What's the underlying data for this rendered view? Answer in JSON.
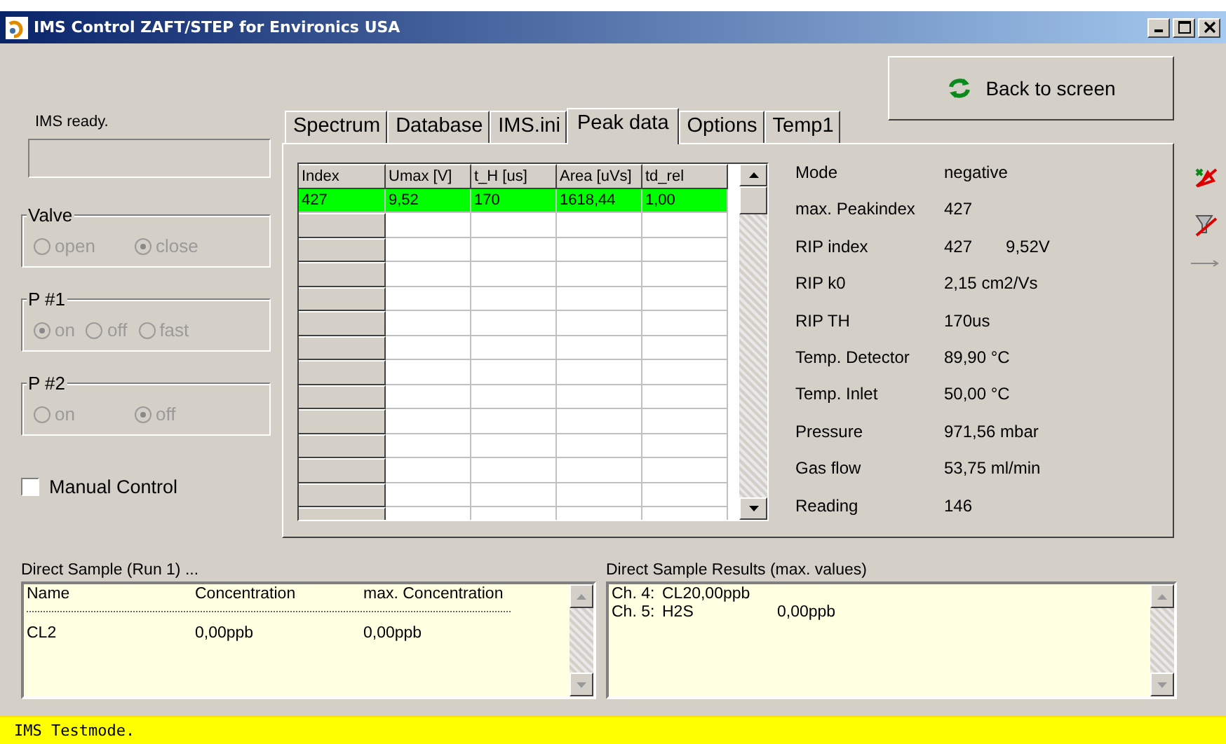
{
  "window": {
    "title": "IMS Control ZAFT/STEP for Environics USA"
  },
  "left": {
    "status": "IMS ready.",
    "groups": [
      {
        "title": "Valve",
        "options": [
          {
            "label": "open",
            "selected": false
          },
          {
            "label": "close",
            "selected": true
          }
        ]
      },
      {
        "title": "P #1",
        "options": [
          {
            "label": "on",
            "selected": true
          },
          {
            "label": "off",
            "selected": false
          },
          {
            "label": "fast",
            "selected": false
          }
        ]
      },
      {
        "title": "P #2",
        "options": [
          {
            "label": "on",
            "selected": false
          },
          {
            "label": "off",
            "selected": true
          }
        ]
      }
    ],
    "manual_control": {
      "label": "Manual Control",
      "checked": false
    }
  },
  "back_button": "Back to screen",
  "tabs": [
    {
      "label": "Spectrum",
      "selected": false
    },
    {
      "label": "Database",
      "selected": false
    },
    {
      "label": "IMS.ini",
      "selected": false
    },
    {
      "label": "Peak data",
      "selected": true
    },
    {
      "label": "Options",
      "selected": false
    },
    {
      "label": "Temp1",
      "selected": false
    }
  ],
  "peak_table": {
    "columns": [
      "Index",
      "Umax [V]",
      "t_H [us]",
      "Area [uVs]",
      "td_rel"
    ],
    "rows": [
      {
        "cells": [
          "427",
          "9,52",
          "170",
          "1618,44",
          "1,00"
        ],
        "highlighted": true
      }
    ]
  },
  "info": [
    {
      "label": "Mode",
      "values": [
        "negative"
      ]
    },
    {
      "label": "max. Peakindex",
      "values": [
        "427"
      ]
    },
    {
      "label": "RIP index",
      "values": [
        "427",
        "9,52V"
      ]
    },
    {
      "label": "RIP k0",
      "values": [
        "2,15 cm2/Vs"
      ]
    },
    {
      "label": "RIP TH",
      "values": [
        "170us"
      ]
    },
    {
      "label": "Temp. Detector",
      "values": [
        "89,90 °C"
      ]
    },
    {
      "label": "Temp. Inlet",
      "values": [
        "50,00 °C"
      ]
    },
    {
      "label": "Pressure",
      "values": [
        "971,56 mbar"
      ]
    },
    {
      "label": "Gas flow",
      "values": [
        "53,75 ml/min"
      ]
    },
    {
      "label": "Reading",
      "values": [
        "146"
      ]
    }
  ],
  "direct_sample": {
    "title": "Direct Sample (Run 1) ...",
    "columns": [
      "Name",
      "Concentration",
      "max. Concentration"
    ],
    "rows": [
      [
        "CL2",
        "0,00ppb",
        "0,00ppb"
      ]
    ]
  },
  "results": {
    "title": "Direct Sample Results (max. values)",
    "lines": [
      {
        "channel": "Ch. 4:",
        "name": "CL20,00ppb"
      },
      {
        "channel": "Ch. 5:",
        "name": "H2S",
        "value": "0,00ppb"
      }
    ]
  },
  "status_bar": "IMS Testmode."
}
